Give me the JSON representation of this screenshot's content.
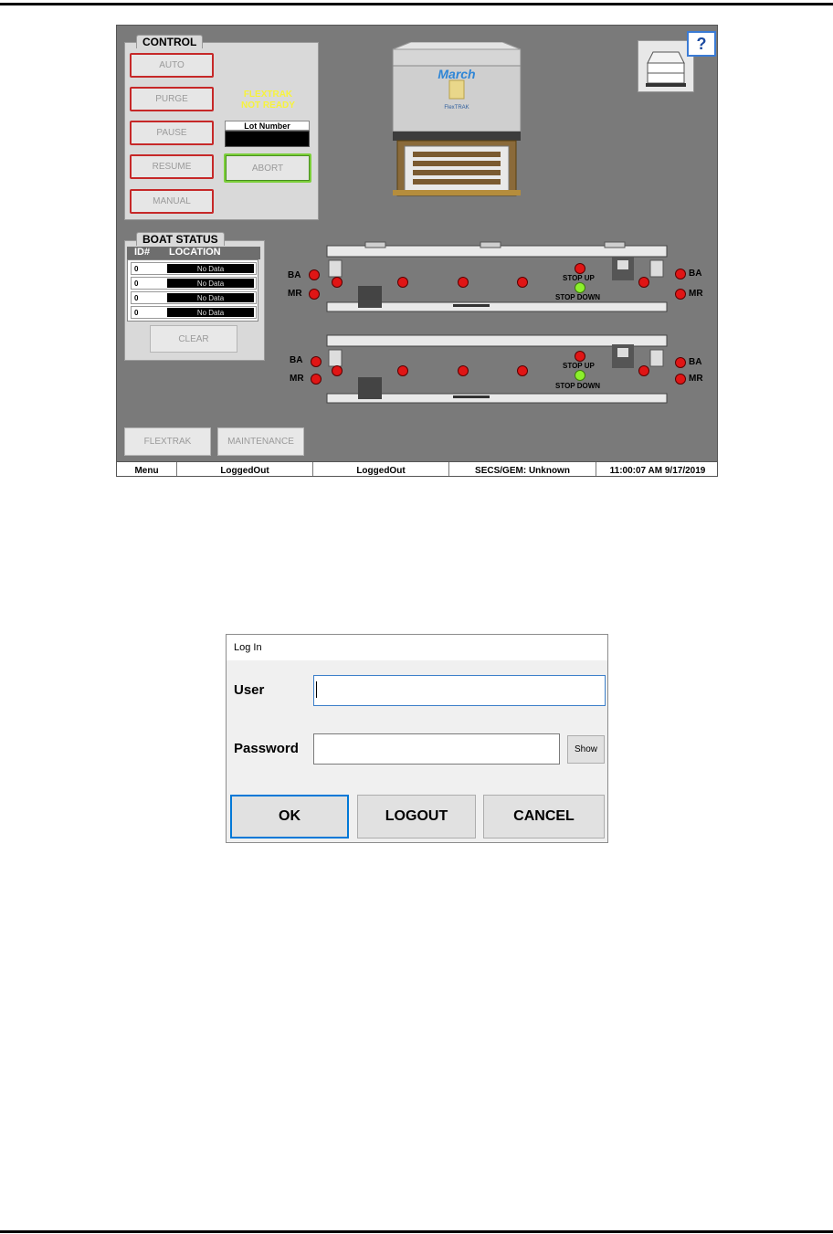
{
  "control": {
    "title": "CONTROL",
    "buttons": [
      "AUTO",
      "PURGE",
      "PAUSE",
      "RESUME",
      "MANUAL"
    ],
    "status_line1": "FLEXTRAK",
    "status_line2": "NOT READY",
    "lot_label": "Lot Number",
    "lot_value": "",
    "abort_label": "ABORT"
  },
  "machine": {
    "brand": "March",
    "model": "FlexTRAK"
  },
  "help_label": "?",
  "boat_status": {
    "title": "BOAT STATUS",
    "col_id": "ID#",
    "col_location": "LOCATION",
    "rows": [
      {
        "id": "0",
        "location": "No Data"
      },
      {
        "id": "0",
        "location": "No Data"
      },
      {
        "id": "0",
        "location": "No Data"
      },
      {
        "id": "0",
        "location": "No Data"
      }
    ],
    "clear_label": "CLEAR"
  },
  "conveyor": {
    "ba_label": "BA",
    "mr_label": "MR",
    "stop_up_label": "STOP UP",
    "stop_down_label": "STOP DOWN",
    "indicator_colors": {
      "off": "#e01515",
      "on": "#8cf02c"
    }
  },
  "nav": {
    "flextrak_label": "FLEXTRAK",
    "maintenance_label": "MAINTENANCE"
  },
  "status_bar": {
    "menu": "Menu",
    "user1": "LoggedOut",
    "user2": "LoggedOut",
    "secs_gem": "SECS/GEM: Unknown",
    "datetime": "11:00:07 AM 9/17/2019"
  },
  "login": {
    "title": "Log In",
    "user_label": "User",
    "user_value": "",
    "password_label": "Password",
    "password_value": "",
    "show_label": "Show",
    "ok_label": "OK",
    "logout_label": "LOGOUT",
    "cancel_label": "CANCEL"
  }
}
